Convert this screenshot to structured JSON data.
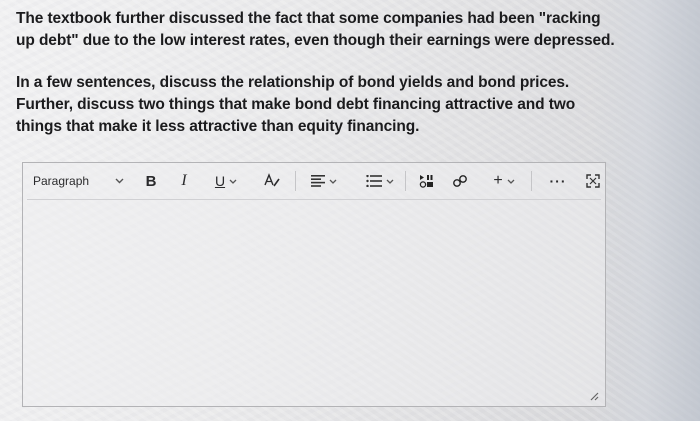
{
  "question": {
    "paragraph_1": "The textbook further discussed the fact that some companies had been \"racking up debt\" due to the low interest rates, even though their earnings were depressed.",
    "paragraph_2": "In a few sentences, discuss the relationship of bond yields and bond prices. Further, discuss two things that make bond debt financing attractive and two things that make it less attractive than equity financing."
  },
  "editor": {
    "toolbar": {
      "paragraph_label": "Paragraph",
      "bold_label": "B",
      "italic_label": "I",
      "underline_label": "U",
      "text_color_label": "A",
      "insert_label": "+",
      "more_label": "···"
    },
    "content": "",
    "icons": {
      "paragraph_chevron": "chevron-down-icon",
      "align": "align-left-icon",
      "list": "bullet-list-icon",
      "media": "media-embed-icon",
      "link": "link-icon",
      "expand": "expand-icon",
      "resize": "resize-grip-icon"
    }
  }
}
